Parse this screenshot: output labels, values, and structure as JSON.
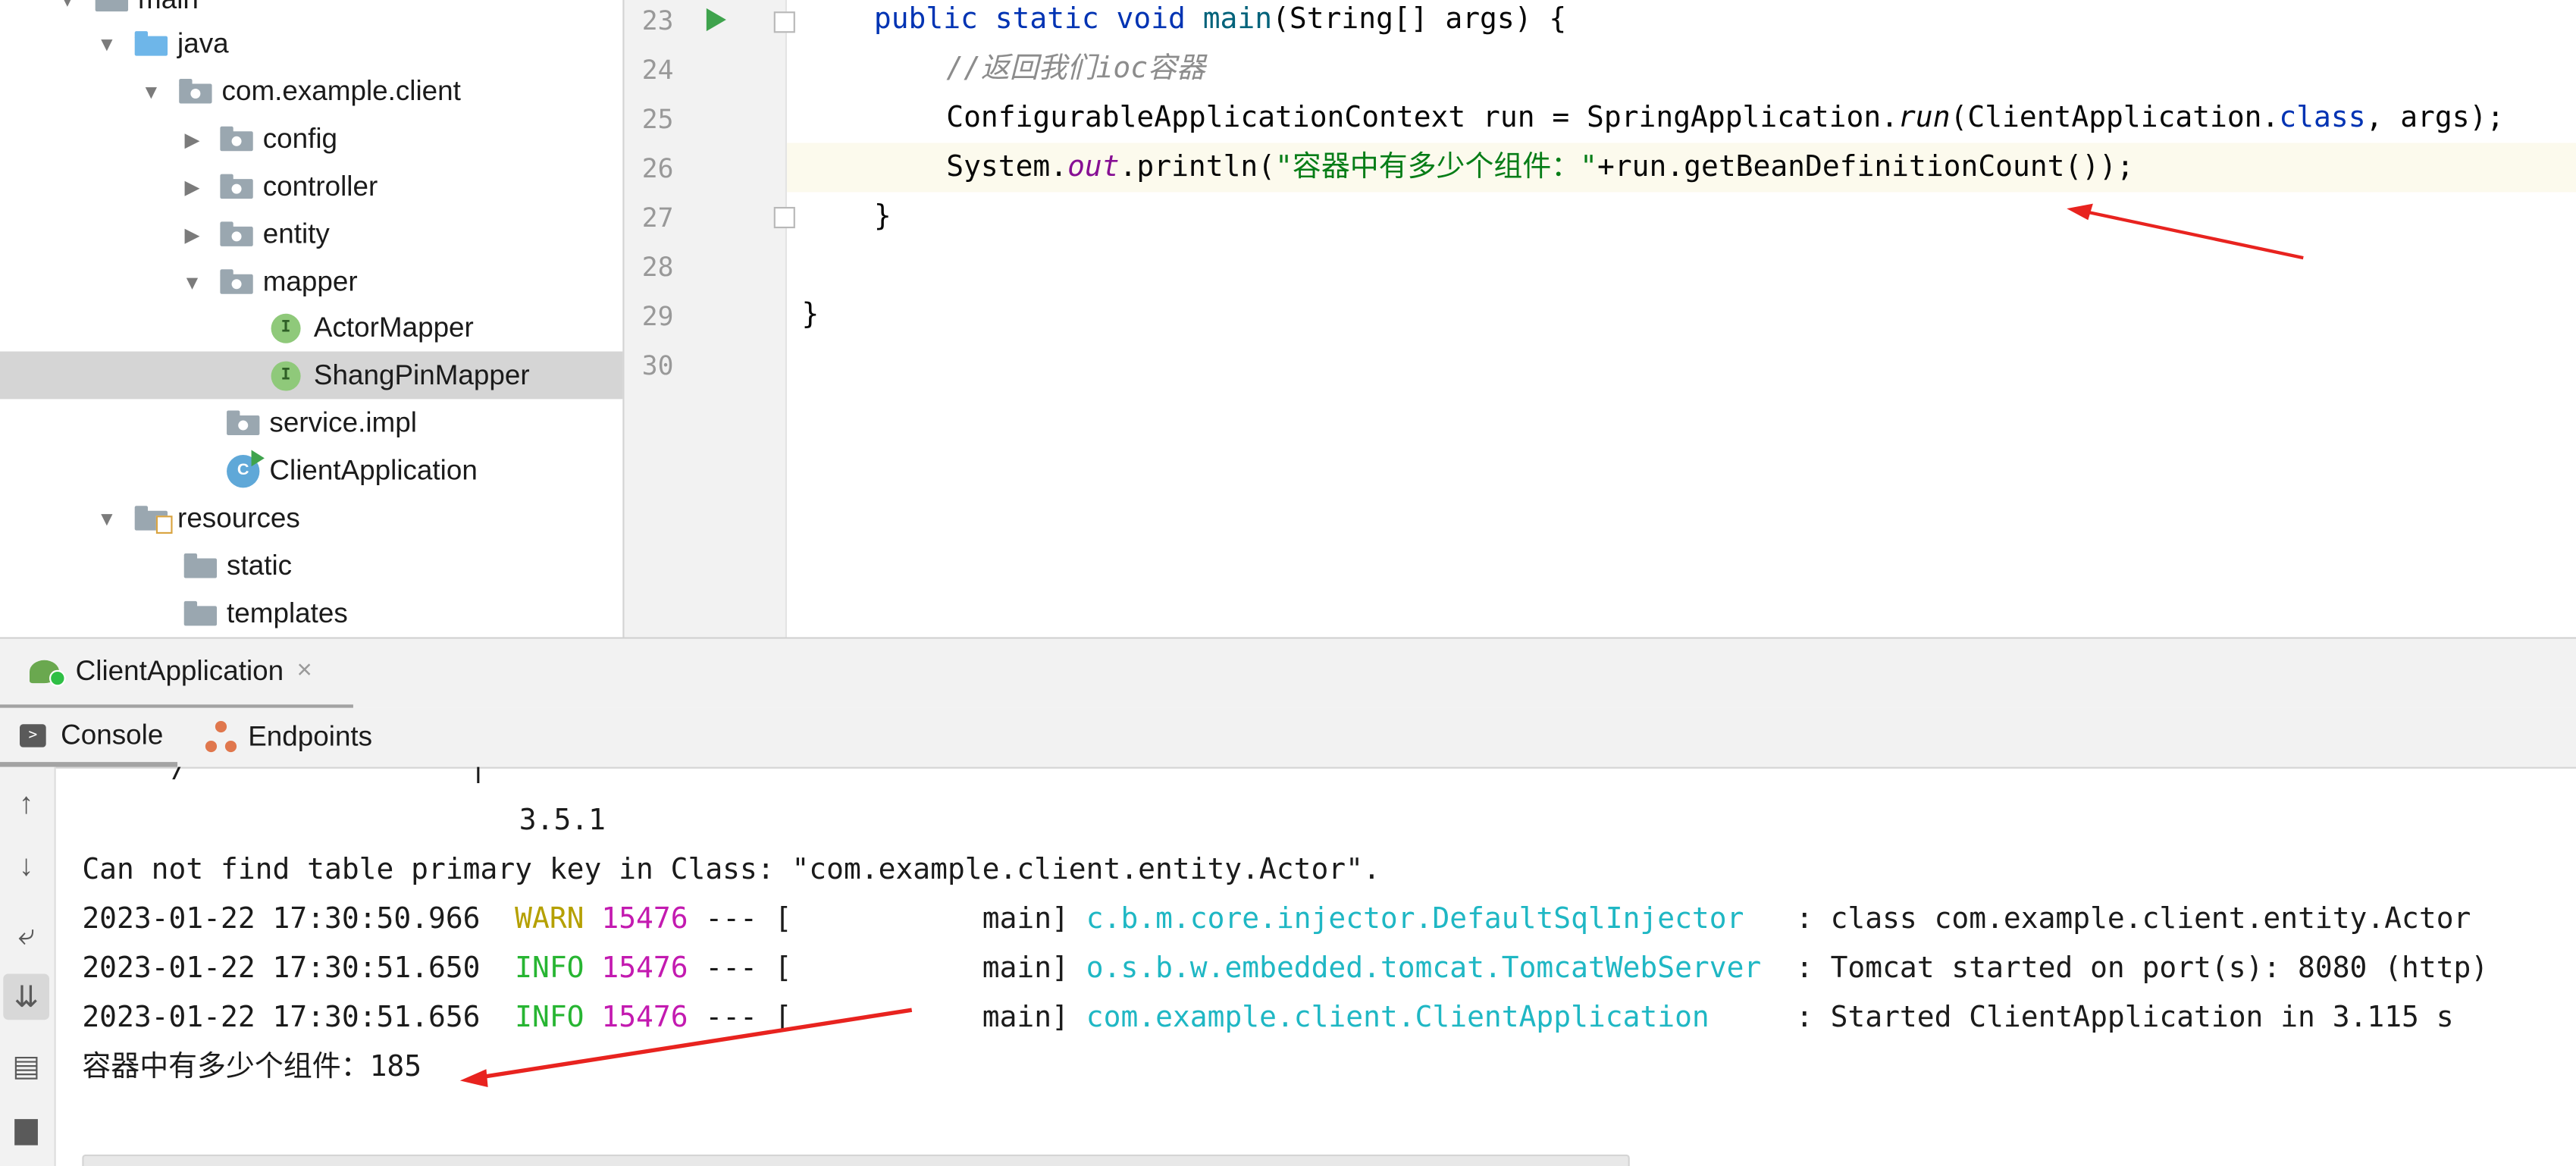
{
  "project_tree": {
    "items": [
      {
        "label": "main",
        "level": 1,
        "icon": "folder-icon",
        "expanded": true
      },
      {
        "label": "java",
        "level": 2,
        "icon": "source-folder-icon",
        "expanded": true
      },
      {
        "label": "com.example.client",
        "level": 3,
        "icon": "package-icon",
        "expanded": true
      },
      {
        "label": "config",
        "level": 4,
        "icon": "package-icon",
        "expanded": false
      },
      {
        "label": "controller",
        "level": 4,
        "icon": "package-icon",
        "expanded": false
      },
      {
        "label": "entity",
        "level": 4,
        "icon": "package-icon",
        "expanded": false
      },
      {
        "label": "mapper",
        "level": 4,
        "icon": "package-icon",
        "expanded": true
      },
      {
        "label": "ActorMapper",
        "level": 5,
        "icon": "interface-icon"
      },
      {
        "label": "ShangPinMapper",
        "level": 5,
        "icon": "interface-icon",
        "selected": true
      },
      {
        "label": "service.impl",
        "level": 4,
        "icon": "package-icon"
      },
      {
        "label": "ClientApplication",
        "level": 4,
        "icon": "spring-boot-class-icon"
      },
      {
        "label": "resources",
        "level": 2,
        "icon": "resources-folder-icon",
        "expanded": true
      },
      {
        "label": "static",
        "level": 3,
        "icon": "folder-icon"
      },
      {
        "label": "templates",
        "level": 3,
        "icon": "folder-icon"
      }
    ]
  },
  "editor": {
    "line_numbers": [
      "23",
      "24",
      "25",
      "26",
      "27",
      "28",
      "29",
      "30"
    ],
    "current_line": "26",
    "code": {
      "l23": {
        "kw1": "public static void ",
        "method": "main",
        "rest": "(String[] args) {"
      },
      "l24": {
        "comment": "//返回我们ioc容器"
      },
      "l25": {
        "a": "ConfigurableApplicationContext run = SpringApplication.",
        "run": "run",
        "b": "(ClientApplication.",
        "cls": "class",
        "c": ", args);"
      },
      "l26": {
        "a": "System.",
        "out": "out",
        "b": ".println(",
        "str": "\"容器中有多少个组件：\"",
        "c": "+run.getBeanDefinitionCount());"
      },
      "l27": "}",
      "l29": "}"
    }
  },
  "run_window": {
    "tab_label": "ClientApplication",
    "close_glyph": "×",
    "subtabs": {
      "console": "Console",
      "endpoints": "Endpoints"
    },
    "console": {
      "ascii_fragment": {
        "slash": "/",
        "bar": "|"
      },
      "version": "3.5.1",
      "lines": [
        {
          "text": "Can not find table primary key in Class: \"com.example.client.entity.Actor\"."
        },
        {
          "time": "2023-01-22 17:30:50.966",
          "level": "WARN",
          "pid": "15476",
          "sep": "--- [",
          "thread": "           main]",
          "logger": "c.b.m.core.injector.DefaultSqlInjector",
          "message": "   : class com.example.client.entity.Actor"
        },
        {
          "time": "2023-01-22 17:30:51.650",
          "level": "INFO",
          "pid": "15476",
          "sep": "--- [",
          "thread": "           main]",
          "logger": "o.s.b.w.embedded.tomcat.TomcatWebServer",
          "message": "  : Tomcat started on port(s): 8080 (http)"
        },
        {
          "time": "2023-01-22 17:30:51.656",
          "level": "INFO",
          "pid": "15476",
          "sep": "--- [",
          "thread": "           main]",
          "logger": "com.example.client.ClientApplication",
          "message": "     : Started ClientApplication in 3.115 s"
        }
      ],
      "result": "容器中有多少个组件：185"
    }
  },
  "colors": {
    "keyword": "#0033b3",
    "string": "#067d17",
    "comment": "#8c8c8c",
    "warn": "#b5a000",
    "info": "#27b532",
    "pid": "#c31ab0",
    "logger": "#1fb7c4",
    "annotation_arrow": "#e8231f"
  }
}
